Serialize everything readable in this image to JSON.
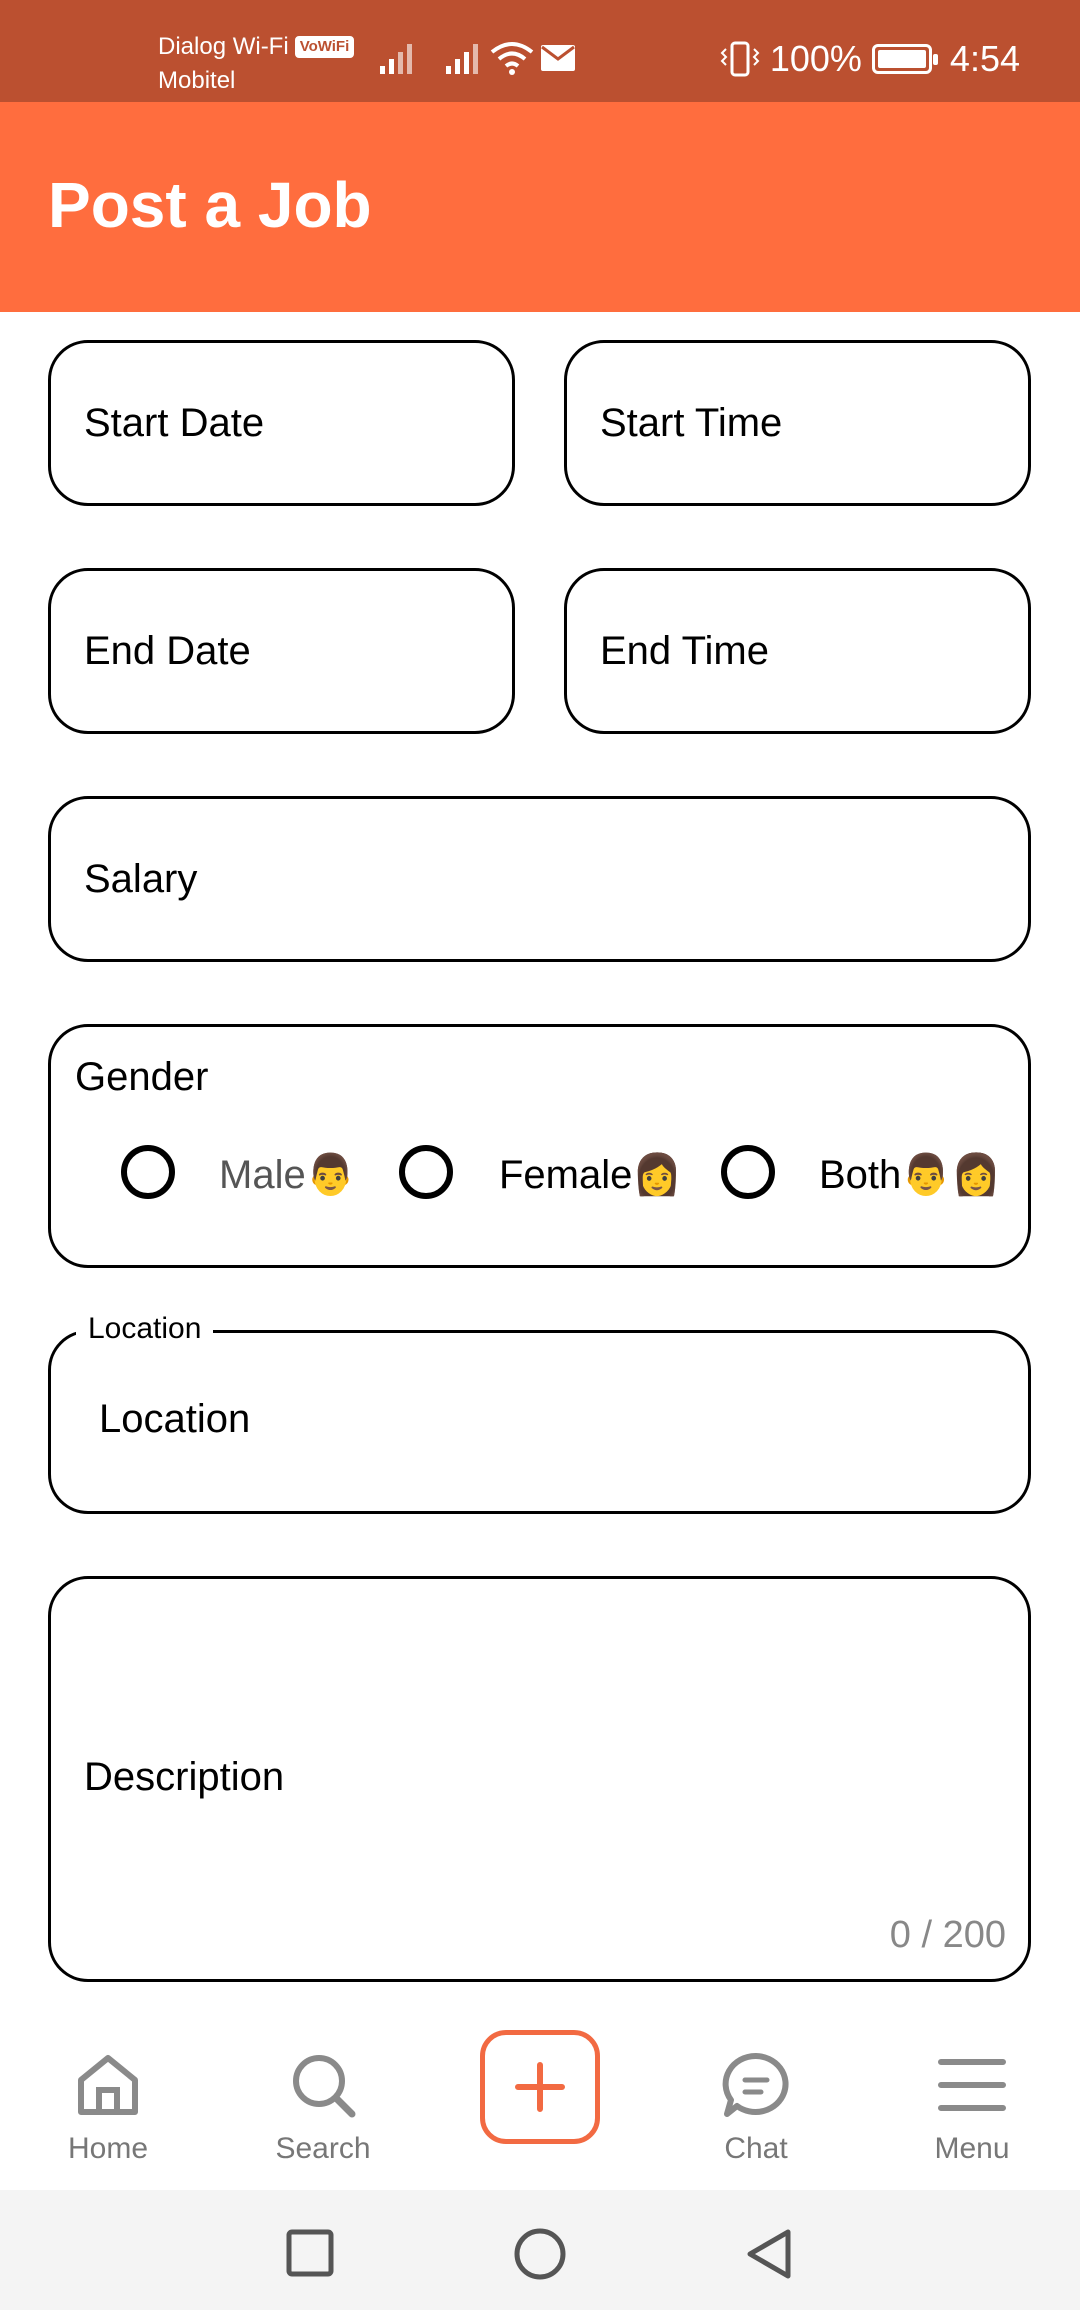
{
  "status_bar": {
    "carrier_1": "Dialog Wi-Fi",
    "vowifi_badge": "VoWiFi",
    "carrier_2": "Mobitel",
    "battery": "100%",
    "time": "4:54"
  },
  "header": {
    "title": "Post a Job"
  },
  "form": {
    "start_date": "Start Date",
    "start_time": "Start Time",
    "end_date": "End Date",
    "end_time": "End Time",
    "salary": "Salary",
    "gender": {
      "label": "Gender",
      "options": [
        {
          "label": "Male👨",
          "selected": false
        },
        {
          "label": "Female👩",
          "selected": false
        },
        {
          "label": "Both👨👩",
          "selected": false
        }
      ]
    },
    "location": {
      "legend": "Location",
      "value": "Location"
    },
    "description": {
      "placeholder": "Description",
      "counter": "0 / 200"
    }
  },
  "bottom_nav": {
    "items": [
      {
        "label": "Home",
        "icon": "home-icon"
      },
      {
        "label": "Search",
        "icon": "search-icon"
      },
      {
        "label": "",
        "icon": "add-icon"
      },
      {
        "label": "Chat",
        "icon": "chat-icon"
      },
      {
        "label": "Menu",
        "icon": "menu-icon"
      }
    ]
  },
  "colors": {
    "status_bar": "#BB5030",
    "header": "#FF6D3E",
    "accent": "#F26A42",
    "nav_text": "#777777"
  }
}
